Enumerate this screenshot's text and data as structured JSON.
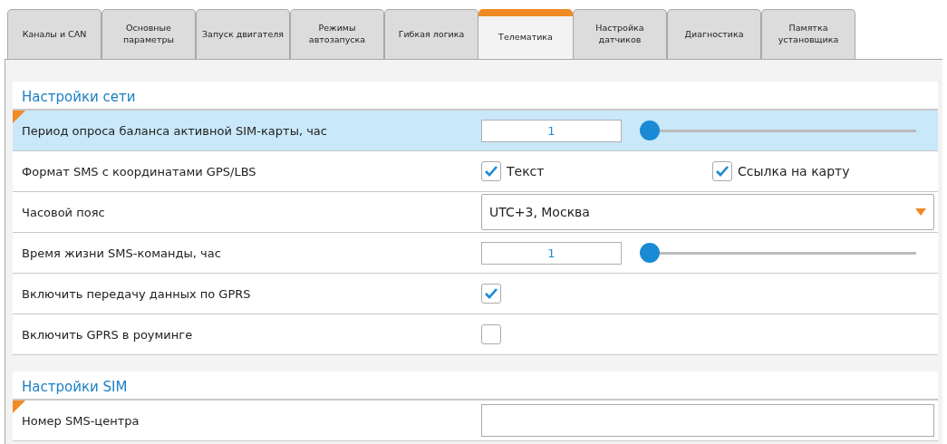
{
  "tabs": [
    {
      "label": "Каналы и CAN",
      "selected": false
    },
    {
      "label": "Основные\nпараметры",
      "selected": false
    },
    {
      "label": "Запуск двигателя",
      "selected": false
    },
    {
      "label": "Режимы\nавтозапуска",
      "selected": false
    },
    {
      "label": "Гибкая логика",
      "selected": false
    },
    {
      "label": "Телематика",
      "selected": true
    },
    {
      "label": "Настройка\nдатчиков",
      "selected": false
    },
    {
      "label": "Диагностика",
      "selected": false
    },
    {
      "label": "Памятка\nустановщика",
      "selected": false
    }
  ],
  "sections": [
    {
      "title": "Настройки сети",
      "rows": [
        {
          "kind": "slider",
          "label": "Период опроса баланса активной SIM-карты, час",
          "value": "1",
          "level": 0,
          "selected": true,
          "modified": true
        },
        {
          "kind": "checks",
          "label": "Формат SMS с координатами GPS/LBS",
          "selected": false,
          "modified": false,
          "options": [
            {
              "label": "Текст",
              "checked": true
            },
            {
              "label": "Ссылка на карту",
              "checked": true
            }
          ]
        },
        {
          "kind": "select",
          "label": "Часовой пояс",
          "value": "UTC+3, Москва",
          "selected": false,
          "modified": false
        },
        {
          "kind": "slider",
          "label": "Время жизни SMS-команды, час",
          "value": "1",
          "level": 0,
          "selected": false,
          "modified": false
        },
        {
          "kind": "check",
          "label": "Включить передачу данных по GPRS",
          "checked": true,
          "selected": false,
          "modified": false
        },
        {
          "kind": "check",
          "label": "Включить GPRS в роуминге",
          "checked": false,
          "selected": false,
          "modified": false
        }
      ]
    },
    {
      "title": "Настройки SIM",
      "rows": [
        {
          "kind": "text",
          "label": "Номер SMS-центра",
          "selected": false,
          "modified": true
        }
      ]
    }
  ]
}
